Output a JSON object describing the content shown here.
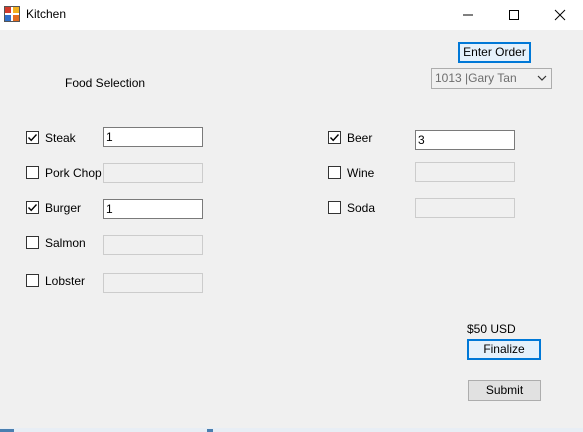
{
  "window": {
    "title": "Kitchen"
  },
  "header": {
    "enter_order_label": "Enter Order",
    "order_select_value": "1013  |Gary  Tan",
    "section_label": "Food Selection"
  },
  "food_items": [
    {
      "label": "Steak",
      "checked": true,
      "quantity": "1"
    },
    {
      "label": "Pork Chop",
      "checked": false,
      "quantity": ""
    },
    {
      "label": "Burger",
      "checked": true,
      "quantity": "1"
    },
    {
      "label": "Salmon",
      "checked": false,
      "quantity": ""
    },
    {
      "label": "Lobster",
      "checked": false,
      "quantity": ""
    }
  ],
  "drink_items": [
    {
      "label": "Beer",
      "checked": true,
      "quantity": "3"
    },
    {
      "label": "Wine",
      "checked": false,
      "quantity": ""
    },
    {
      "label": "Soda",
      "checked": false,
      "quantity": ""
    }
  ],
  "footer": {
    "total_text": "$50 USD",
    "finalize_label": "Finalize",
    "submit_label": "Submit"
  },
  "colors": {
    "focus_accent": "#0078d7",
    "background": "#f0f0f0"
  },
  "icons": {
    "app": "kitchen-app-icon",
    "minimize": "minimize-icon",
    "maximize": "maximize-icon",
    "close": "close-icon"
  }
}
